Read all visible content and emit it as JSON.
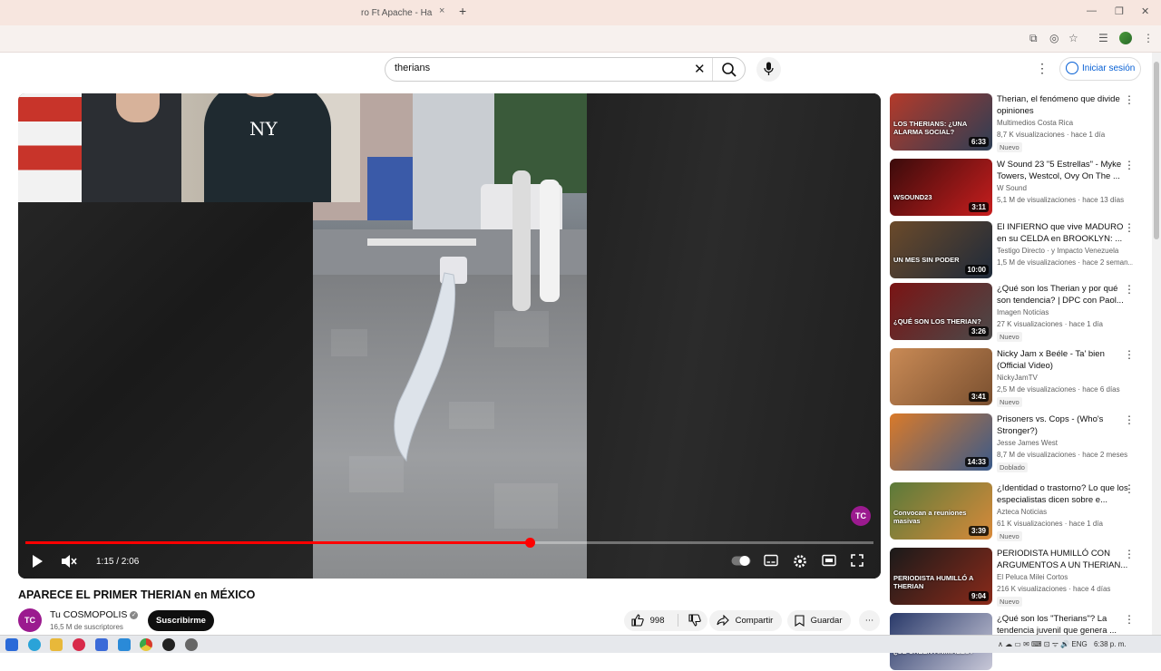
{
  "browser": {
    "tab_title": "ro Ft Apache - Ha",
    "tab_close": "×",
    "new_tab": "+",
    "win_min": "—",
    "win_max": "❐",
    "win_close": "✕"
  },
  "header": {
    "search_value": "therians",
    "search_clear": "✕",
    "signin_label": "Iniciar sesión",
    "more": "⋮"
  },
  "player": {
    "time": "1:15 / 2:06",
    "progress": 0.595,
    "logo": "TC"
  },
  "video": {
    "title": "APARECE EL PRIMER THERIAN en MÉXICO",
    "channel_name": "Tu COSMOPOLIS",
    "channel_subs": "16,5 M de suscriptores",
    "channel_avatar": "TC",
    "subscribe_label": "Suscribirme",
    "likes": "998",
    "share_label": "Compartir",
    "save_label": "Guardar",
    "more": "⋯"
  },
  "recommendations": [
    {
      "title": "Therian, el fenómeno que divide opiniones",
      "channel": "Multimedios Costa Rica",
      "meta": "8,7 K visualizaciones · hace 1 día",
      "badge": "Nuevo",
      "duration": "6:33",
      "colors": [
        "#b43a2a",
        "#2c3e55"
      ],
      "overlay": "LOS THERIANS: ¿UNA ALARMA SOCIAL?"
    },
    {
      "title": "W Sound 23 \"5 Estrellas\" - Myke Towers, Westcol, Ovy On The ...",
      "channel": "W Sound",
      "meta": "5,1 M de visualizaciones · hace 13 días",
      "badge": "",
      "duration": "3:11",
      "colors": [
        "#3a0b0b",
        "#c81e1e"
      ],
      "overlay": "WSOUND23"
    },
    {
      "title": "El INFIERNO que vive MADURO en su CELDA en BROOKLYN: ...",
      "channel": "Testigo Directo · y Impacto Venezuela",
      "meta": "1,5 M de visualizaciones · hace 2 seman...",
      "badge": "",
      "duration": "10:00",
      "colors": [
        "#6b4a2a",
        "#1e2a3a"
      ],
      "overlay": "UN MES SIN PODER"
    },
    {
      "title": "¿Qué son los Therian y por qué son tendencia? | DPC con Paol...",
      "channel": "Imagen Noticias",
      "meta": "27 K visualizaciones · hace 1 día",
      "badge": "Nuevo",
      "duration": "3:26",
      "colors": [
        "#7a1414",
        "#4a4a4a"
      ],
      "overlay": "¿QUÉ SON LOS THERIAN?"
    },
    {
      "title": "Nicky Jam x Beéle - Ta' bien (Official Video)",
      "channel": "NickyJamTV",
      "meta": "2,5 M de visualizaciones · hace 6 días",
      "badge": "Nuevo",
      "duration": "3:41",
      "colors": [
        "#c98a55",
        "#7a5030"
      ],
      "overlay": ""
    },
    {
      "title": "Prisoners vs. Cops - (Who's Stronger?)",
      "channel": "Jesse James West",
      "meta": "8,7 M de visualizaciones · hace 2 meses",
      "badge": "Doblado",
      "duration": "14:33",
      "colors": [
        "#d97a2a",
        "#3a5a8a"
      ],
      "overlay": ""
    },
    {
      "title": "¿Identidad o trastorno? Lo que los especialistas dicen sobre e...",
      "channel": "Azteca Noticias",
      "meta": "61 K visualizaciones · hace 1 día",
      "badge": "Nuevo",
      "duration": "3:39",
      "colors": [
        "#5a7a3a",
        "#d98a3a"
      ],
      "overlay": "Convocan a reuniones masivas"
    },
    {
      "title": "PERIODISTA HUMILLÓ CON ARGUMENTOS A UN THERIAN...",
      "channel": "El Peluca Milei Cortos",
      "meta": "216 K visualizaciones · hace 4 días",
      "badge": "Nuevo",
      "duration": "9:04",
      "colors": [
        "#1a1a1a",
        "#8a2a1a"
      ],
      "overlay": "PERIODISTA HUMILLÓ A THERIAN"
    },
    {
      "title": "¿Qué son los \"Therians\"? La tendencia juvenil que genera ...",
      "channel": "",
      "meta": "",
      "badge": "",
      "duration": "",
      "colors": [
        "#2a3a6a",
        "#c8c8d8"
      ],
      "overlay": "¿SE CREEN ANIMALES?"
    }
  ],
  "taskbar": {
    "tray": "∧  ☁  ▭  ✉  ⌨  ⊡  ᯤ  🔊  ENG",
    "clock": "6:38 p. m."
  },
  "colors": {
    "accent": "#f00",
    "link": "#065fd4",
    "brand": "#9b1a8f"
  }
}
